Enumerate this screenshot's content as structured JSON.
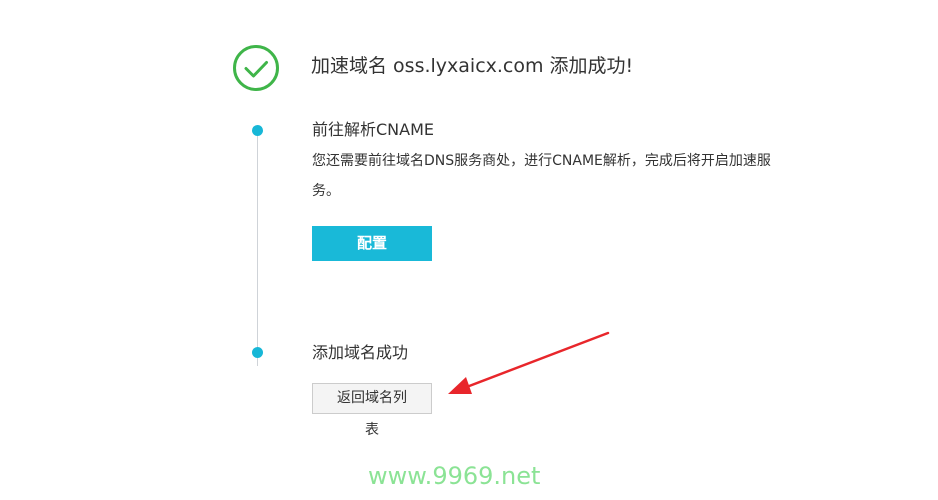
{
  "header": {
    "icon": "check-circle-icon",
    "title": "加速域名 oss.lyxaicx.com 添加成功!"
  },
  "steps": [
    {
      "title": "前往解析CNAME",
      "description": "您还需要前往域名DNS服务商处，进行CNAME解析，完成后将开启加速服务。",
      "button_label": "配置"
    },
    {
      "title": "添加域名成功",
      "button_label": "返回域名列",
      "button_label_overflow": "表"
    }
  ],
  "watermark": "www.9969.net",
  "colors": {
    "accent": "#19b9d8",
    "success": "#3fb549",
    "arrow": "#e8262b"
  }
}
